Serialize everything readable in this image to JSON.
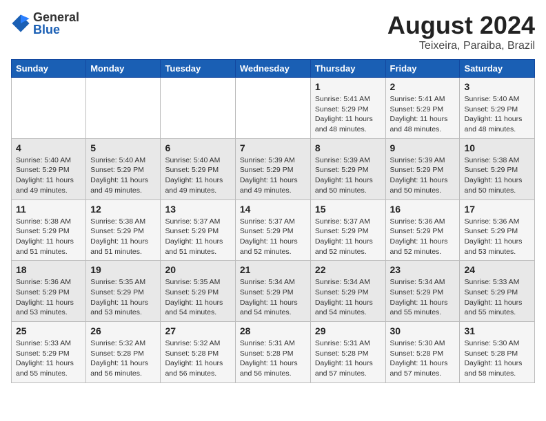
{
  "header": {
    "logo_general": "General",
    "logo_blue": "Blue",
    "month_year": "August 2024",
    "location": "Teixeira, Paraiba, Brazil"
  },
  "weekdays": [
    "Sunday",
    "Monday",
    "Tuesday",
    "Wednesday",
    "Thursday",
    "Friday",
    "Saturday"
  ],
  "weeks": [
    [
      {
        "day": "",
        "info": ""
      },
      {
        "day": "",
        "info": ""
      },
      {
        "day": "",
        "info": ""
      },
      {
        "day": "",
        "info": ""
      },
      {
        "day": "1",
        "info": "Sunrise: 5:41 AM\nSunset: 5:29 PM\nDaylight: 11 hours\nand 48 minutes."
      },
      {
        "day": "2",
        "info": "Sunrise: 5:41 AM\nSunset: 5:29 PM\nDaylight: 11 hours\nand 48 minutes."
      },
      {
        "day": "3",
        "info": "Sunrise: 5:40 AM\nSunset: 5:29 PM\nDaylight: 11 hours\nand 48 minutes."
      }
    ],
    [
      {
        "day": "4",
        "info": "Sunrise: 5:40 AM\nSunset: 5:29 PM\nDaylight: 11 hours\nand 49 minutes."
      },
      {
        "day": "5",
        "info": "Sunrise: 5:40 AM\nSunset: 5:29 PM\nDaylight: 11 hours\nand 49 minutes."
      },
      {
        "day": "6",
        "info": "Sunrise: 5:40 AM\nSunset: 5:29 PM\nDaylight: 11 hours\nand 49 minutes."
      },
      {
        "day": "7",
        "info": "Sunrise: 5:39 AM\nSunset: 5:29 PM\nDaylight: 11 hours\nand 49 minutes."
      },
      {
        "day": "8",
        "info": "Sunrise: 5:39 AM\nSunset: 5:29 PM\nDaylight: 11 hours\nand 50 minutes."
      },
      {
        "day": "9",
        "info": "Sunrise: 5:39 AM\nSunset: 5:29 PM\nDaylight: 11 hours\nand 50 minutes."
      },
      {
        "day": "10",
        "info": "Sunrise: 5:38 AM\nSunset: 5:29 PM\nDaylight: 11 hours\nand 50 minutes."
      }
    ],
    [
      {
        "day": "11",
        "info": "Sunrise: 5:38 AM\nSunset: 5:29 PM\nDaylight: 11 hours\nand 51 minutes."
      },
      {
        "day": "12",
        "info": "Sunrise: 5:38 AM\nSunset: 5:29 PM\nDaylight: 11 hours\nand 51 minutes."
      },
      {
        "day": "13",
        "info": "Sunrise: 5:37 AM\nSunset: 5:29 PM\nDaylight: 11 hours\nand 51 minutes."
      },
      {
        "day": "14",
        "info": "Sunrise: 5:37 AM\nSunset: 5:29 PM\nDaylight: 11 hours\nand 52 minutes."
      },
      {
        "day": "15",
        "info": "Sunrise: 5:37 AM\nSunset: 5:29 PM\nDaylight: 11 hours\nand 52 minutes."
      },
      {
        "day": "16",
        "info": "Sunrise: 5:36 AM\nSunset: 5:29 PM\nDaylight: 11 hours\nand 52 minutes."
      },
      {
        "day": "17",
        "info": "Sunrise: 5:36 AM\nSunset: 5:29 PM\nDaylight: 11 hours\nand 53 minutes."
      }
    ],
    [
      {
        "day": "18",
        "info": "Sunrise: 5:36 AM\nSunset: 5:29 PM\nDaylight: 11 hours\nand 53 minutes."
      },
      {
        "day": "19",
        "info": "Sunrise: 5:35 AM\nSunset: 5:29 PM\nDaylight: 11 hours\nand 53 minutes."
      },
      {
        "day": "20",
        "info": "Sunrise: 5:35 AM\nSunset: 5:29 PM\nDaylight: 11 hours\nand 54 minutes."
      },
      {
        "day": "21",
        "info": "Sunrise: 5:34 AM\nSunset: 5:29 PM\nDaylight: 11 hours\nand 54 minutes."
      },
      {
        "day": "22",
        "info": "Sunrise: 5:34 AM\nSunset: 5:29 PM\nDaylight: 11 hours\nand 54 minutes."
      },
      {
        "day": "23",
        "info": "Sunrise: 5:34 AM\nSunset: 5:29 PM\nDaylight: 11 hours\nand 55 minutes."
      },
      {
        "day": "24",
        "info": "Sunrise: 5:33 AM\nSunset: 5:29 PM\nDaylight: 11 hours\nand 55 minutes."
      }
    ],
    [
      {
        "day": "25",
        "info": "Sunrise: 5:33 AM\nSunset: 5:29 PM\nDaylight: 11 hours\nand 55 minutes."
      },
      {
        "day": "26",
        "info": "Sunrise: 5:32 AM\nSunset: 5:28 PM\nDaylight: 11 hours\nand 56 minutes."
      },
      {
        "day": "27",
        "info": "Sunrise: 5:32 AM\nSunset: 5:28 PM\nDaylight: 11 hours\nand 56 minutes."
      },
      {
        "day": "28",
        "info": "Sunrise: 5:31 AM\nSunset: 5:28 PM\nDaylight: 11 hours\nand 56 minutes."
      },
      {
        "day": "29",
        "info": "Sunrise: 5:31 AM\nSunset: 5:28 PM\nDaylight: 11 hours\nand 57 minutes."
      },
      {
        "day": "30",
        "info": "Sunrise: 5:30 AM\nSunset: 5:28 PM\nDaylight: 11 hours\nand 57 minutes."
      },
      {
        "day": "31",
        "info": "Sunrise: 5:30 AM\nSunset: 5:28 PM\nDaylight: 11 hours\nand 58 minutes."
      }
    ]
  ]
}
